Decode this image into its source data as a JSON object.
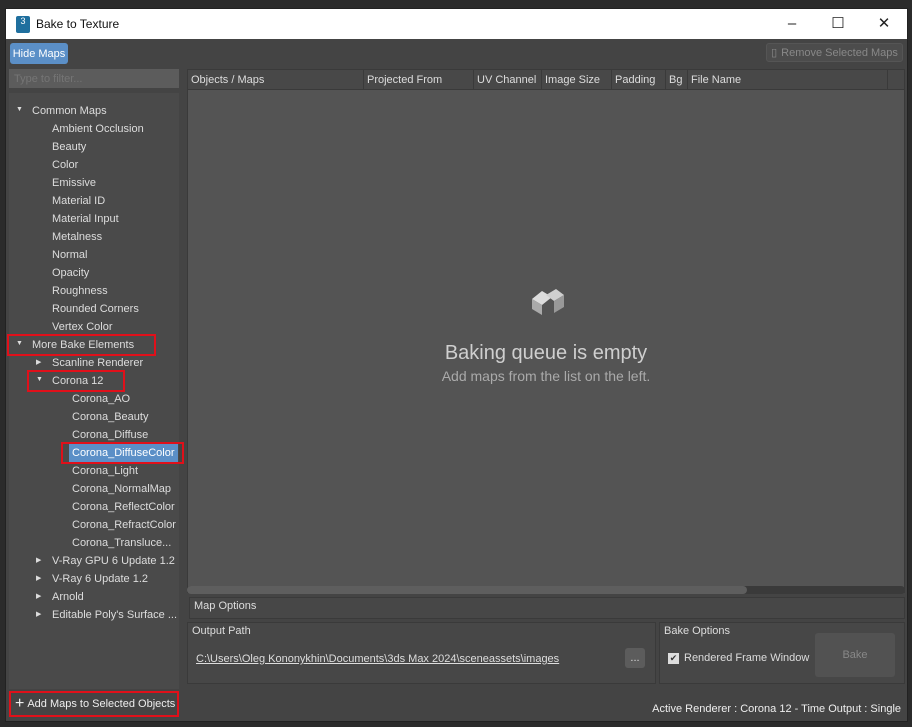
{
  "window": {
    "title": "Bake to Texture",
    "app_icon": "3"
  },
  "toolbar": {
    "hide_maps": "Hide Maps",
    "remove_selected": "Remove Selected Maps"
  },
  "filter": {
    "placeholder": "Type to filter..."
  },
  "tree": [
    {
      "label": "Common Maps",
      "level": 0,
      "expanded": true
    },
    {
      "label": "Ambient Occlusion",
      "level": 1
    },
    {
      "label": "Beauty",
      "level": 1
    },
    {
      "label": "Color",
      "level": 1
    },
    {
      "label": "Emissive",
      "level": 1
    },
    {
      "label": "Material ID",
      "level": 1
    },
    {
      "label": "Material Input",
      "level": 1
    },
    {
      "label": "Metalness",
      "level": 1
    },
    {
      "label": "Normal",
      "level": 1
    },
    {
      "label": "Opacity",
      "level": 1
    },
    {
      "label": "Roughness",
      "level": 1
    },
    {
      "label": "Rounded Corners",
      "level": 1
    },
    {
      "label": "Vertex Color",
      "level": 1
    },
    {
      "label": "More Bake Elements",
      "level": 0,
      "expanded": true,
      "highlighted": true
    },
    {
      "label": "Scanline Renderer",
      "level": 1,
      "expanded": false
    },
    {
      "label": "Corona 12",
      "level": 1,
      "expanded": true,
      "highlighted": true
    },
    {
      "label": "Corona_AO",
      "level": 2
    },
    {
      "label": "Corona_Beauty",
      "level": 2
    },
    {
      "label": "Corona_Diffuse",
      "level": 2
    },
    {
      "label": "Corona_DiffuseColor",
      "level": 2,
      "selected": true,
      "highlighted": true
    },
    {
      "label": "Corona_Light",
      "level": 2
    },
    {
      "label": "Corona_NormalMap",
      "level": 2
    },
    {
      "label": "Corona_ReflectColor",
      "level": 2
    },
    {
      "label": "Corona_RefractColor",
      "level": 2
    },
    {
      "label": "Corona_Transluce...",
      "level": 2
    },
    {
      "label": "V-Ray GPU 6 Update 1.2",
      "level": 1,
      "expanded": false
    },
    {
      "label": "V-Ray 6 Update 1.2",
      "level": 1,
      "expanded": false
    },
    {
      "label": "Arnold",
      "level": 1,
      "expanded": false
    },
    {
      "label": "Editable Poly's Surface ...",
      "level": 1,
      "expanded": false
    }
  ],
  "add_maps": "Add Maps to Selected Objects",
  "table": {
    "columns": [
      "Objects / Maps",
      "Projected From",
      "UV Channel",
      "Image Size",
      "Padding",
      "Bg",
      "File Name"
    ]
  },
  "empty": {
    "title": "Baking queue is empty",
    "subtitle": "Add maps from the list on the left."
  },
  "map_options": "Map Options",
  "output": {
    "label": "Output Path",
    "path": "C:\\Users\\Oleg Kononykhin\\Documents\\3ds Max 2024\\sceneassets\\images",
    "browse": "..."
  },
  "bake_options": {
    "label": "Bake Options",
    "rendered_frame_window": "Rendered Frame Window",
    "checked": true,
    "bake": "Bake"
  },
  "status": "Active Renderer : Corona 12  -  Time Output : Single",
  "colors": {
    "accent": "#5b8fc7",
    "highlight": "#e0101a"
  }
}
